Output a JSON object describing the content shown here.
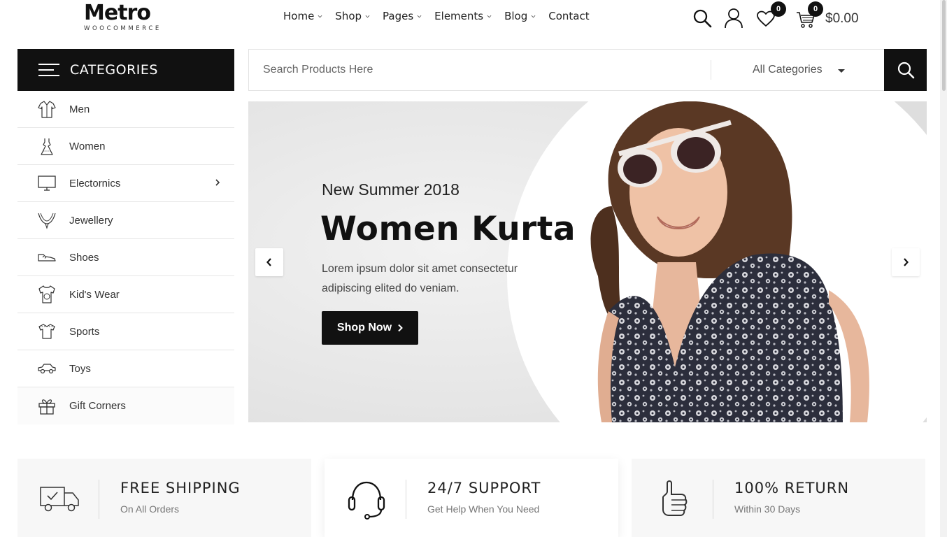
{
  "header": {
    "logo": {
      "mark": "Metro",
      "sub": "WOOCOMMERCE"
    },
    "nav": [
      {
        "label": "Home",
        "has_dropdown": true
      },
      {
        "label": "Shop",
        "has_dropdown": true
      },
      {
        "label": "Pages",
        "has_dropdown": true
      },
      {
        "label": "Elements",
        "has_dropdown": true
      },
      {
        "label": "Blog",
        "has_dropdown": true
      },
      {
        "label": "Contact",
        "has_dropdown": false
      }
    ],
    "wishlist_count": "0",
    "cart_count": "0",
    "cart_total": "$0.00",
    "icons": [
      "search-icon",
      "user-icon",
      "heart-icon",
      "cart-icon"
    ]
  },
  "categories": {
    "title": "CATEGORIES",
    "items": [
      {
        "label": "Men",
        "icon": "shirt-icon"
      },
      {
        "label": "Women",
        "icon": "dress-icon"
      },
      {
        "label": "Electornics",
        "icon": "monitor-icon",
        "has_submenu": true
      },
      {
        "label": "Jewellery",
        "icon": "necklace-icon"
      },
      {
        "label": "Shoes",
        "icon": "shoe-icon"
      },
      {
        "label": "Kid's Wear",
        "icon": "kids-shirt-icon"
      },
      {
        "label": "Sports",
        "icon": "jersey-icon"
      },
      {
        "label": "Toys",
        "icon": "toy-car-icon"
      },
      {
        "label": "Gift Corners",
        "icon": "gift-icon"
      }
    ]
  },
  "search": {
    "placeholder": "Search Products Here",
    "category": "All Categories"
  },
  "hero": {
    "subtitle": "New Summer 2018",
    "title": "Women Kurta",
    "description": "Lorem ipsum dolor sit amet consectetur adipiscing elited do veniam.",
    "button": "Shop Now"
  },
  "features": [
    {
      "title": "FREE SHIPPING",
      "subtitle": "On All Orders",
      "icon": "truck-icon"
    },
    {
      "title": "24/7 SUPPORT",
      "subtitle": "Get Help When You Need",
      "icon": "headset-icon"
    },
    {
      "title": "100% RETURN",
      "subtitle": "Within 30 Days",
      "icon": "thumbs-up-icon"
    }
  ],
  "colors": {
    "primary": "#111111",
    "text": "#222222",
    "muted": "#777777",
    "border": "#e6e6e6"
  }
}
